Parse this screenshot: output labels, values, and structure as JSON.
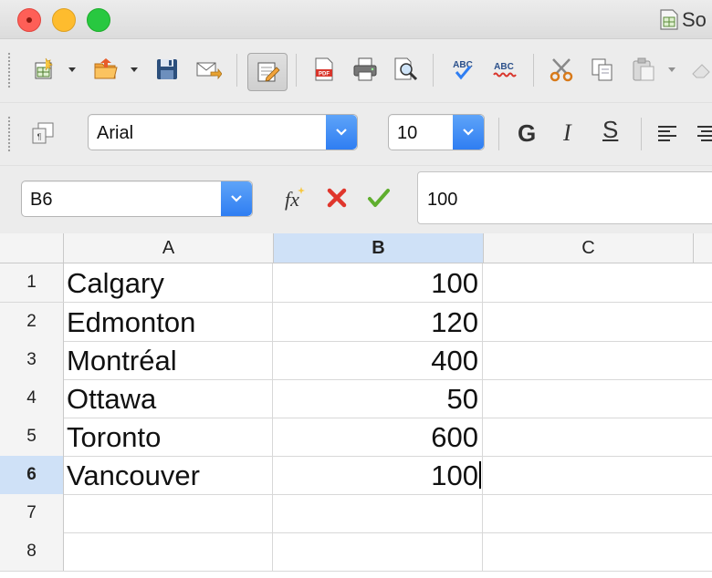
{
  "window": {
    "title": "So"
  },
  "toolbar2": {
    "font_name": "Arial",
    "font_size": "10",
    "bold": "G",
    "italic": "I",
    "strike": "S"
  },
  "formula_bar": {
    "name_box": "B6",
    "content": "100"
  },
  "sheet": {
    "columns": [
      "A",
      "B",
      "C"
    ],
    "selected_column": "B",
    "rows": [
      {
        "num": "1",
        "a": "Calgary",
        "b": "100"
      },
      {
        "num": "2",
        "a": "Edmonton",
        "b": "120"
      },
      {
        "num": "3",
        "a": "Montréal",
        "b": "400"
      },
      {
        "num": "4",
        "a": "Ottawa",
        "b": "50"
      },
      {
        "num": "5",
        "a": "Toronto",
        "b": "600"
      },
      {
        "num": "6",
        "a": "Vancouver",
        "b": "100"
      },
      {
        "num": "7",
        "a": "",
        "b": ""
      },
      {
        "num": "8",
        "a": "",
        "b": ""
      }
    ],
    "selected_row": "6"
  },
  "colors": {
    "accent": "#2f7ef2",
    "selection_header": "#cfe1f7",
    "close": "#fe5f57",
    "minimize": "#febc2e",
    "maximize": "#28c840"
  },
  "icons": [
    "new-spreadsheet-icon",
    "open-folder-icon",
    "save-icon",
    "email-icon",
    "edit-mode-icon",
    "export-pdf-icon",
    "print-icon",
    "print-preview-icon",
    "spellcheck-icon",
    "autospellcheck-icon",
    "cut-icon",
    "copy-icon",
    "paste-icon",
    "clear-format-icon",
    "styles-icon",
    "function-wizard-icon",
    "cancel-icon",
    "accept-icon",
    "align-left-icon",
    "align-center-icon"
  ]
}
